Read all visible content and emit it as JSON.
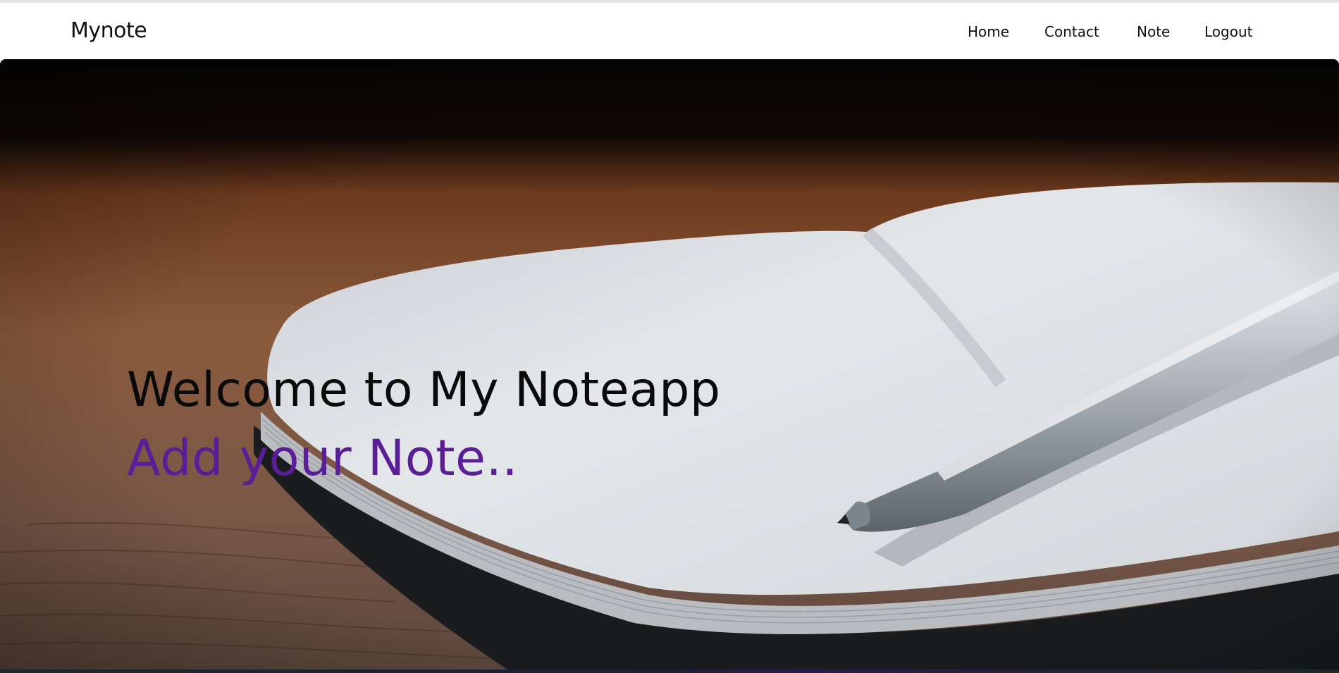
{
  "navbar": {
    "brand": "Mynote",
    "links": [
      {
        "label": "Home"
      },
      {
        "label": "Contact"
      },
      {
        "label": "Note"
      },
      {
        "label": "Logout"
      }
    ]
  },
  "hero": {
    "title": "Welcome to My Noteapp",
    "subtitle": "Add your Note..",
    "subtitle_color": "#5a1e96"
  }
}
